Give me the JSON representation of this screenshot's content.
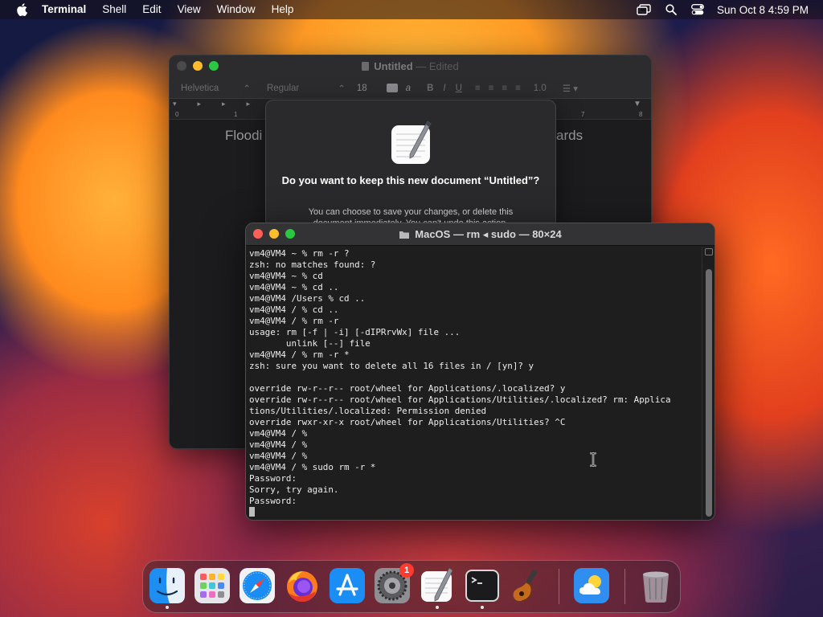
{
  "menubar": {
    "app_name": "Terminal",
    "items": [
      "Shell",
      "Edit",
      "View",
      "Window",
      "Help"
    ],
    "clock": "Sun Oct 8  4:59 PM"
  },
  "textedit": {
    "title": "Untitled",
    "title_suffix": "— Edited",
    "toolbar": {
      "font_family": "Helvetica",
      "font_style": "Regular",
      "font_size": "18",
      "line_spacing": "1.0"
    },
    "ruler_ticks": [
      "0",
      "1",
      "7",
      "8"
    ],
    "doc_text_left": "Floodi",
    "doc_text_right": "ards"
  },
  "save_sheet": {
    "title": "Do you want to keep this new document “Untitled”?",
    "body": "You can choose to save your changes, or delete this document immediately. You can't undo this action."
  },
  "terminal": {
    "title": "MacOS — rm ◂ sudo — 80×24",
    "lines": [
      "vm4@VM4 ~ % rm -r ?",
      "zsh: no matches found: ?",
      "vm4@VM4 ~ % cd",
      "vm4@VM4 ~ % cd ..",
      "vm4@VM4 /Users % cd ..",
      "vm4@VM4 / % cd ..",
      "vm4@VM4 / % rm -r",
      "usage: rm [-f | -i] [-dIPRrvWx] file ...",
      "       unlink [--] file",
      "vm4@VM4 / % rm -r *",
      "zsh: sure you want to delete all 16 files in / [yn]? y",
      "",
      "override rw-r--r-- root/wheel for Applications/.localized? y",
      "override rw-r--r-- root/wheel for Applications/Utilities/.localized? rm: Applica",
      "tions/Utilities/.localized: Permission denied",
      "override rwxr-xr-x root/wheel for Applications/Utilities? ^C",
      "vm4@VM4 / %",
      "vm4@VM4 / %",
      "vm4@VM4 / %",
      "vm4@VM4 / % sudo rm -r *",
      "Password:",
      "Sorry, try again.",
      "Password:"
    ]
  },
  "dock": {
    "apps": [
      {
        "name": "Finder",
        "icon": "finder-icon",
        "running": true
      },
      {
        "name": "Launchpad",
        "icon": "launchpad-icon",
        "running": false
      },
      {
        "name": "Safari",
        "icon": "safari-icon",
        "running": false
      },
      {
        "name": "Firefox",
        "icon": "firefox-icon",
        "running": false
      },
      {
        "name": "App Store",
        "icon": "app-store-icon",
        "running": false
      },
      {
        "name": "System Settings",
        "icon": "system-settings-icon",
        "running": false,
        "badge": "1"
      },
      {
        "name": "TextEdit",
        "icon": "textedit-icon",
        "running": true
      },
      {
        "name": "Terminal",
        "icon": "terminal-icon",
        "running": true
      },
      {
        "name": "GarageBand",
        "icon": "garageband-icon",
        "running": false
      },
      {
        "name": "Weather",
        "icon": "weather-icon",
        "running": false
      },
      {
        "name": "Trash",
        "icon": "trash-icon",
        "running": false
      }
    ]
  },
  "colors": {
    "close": "#ff5f57",
    "minimize": "#febc2e",
    "zoom": "#28c840",
    "terminal_bg": "#1e1e1e",
    "badge": "#ff3b30"
  }
}
